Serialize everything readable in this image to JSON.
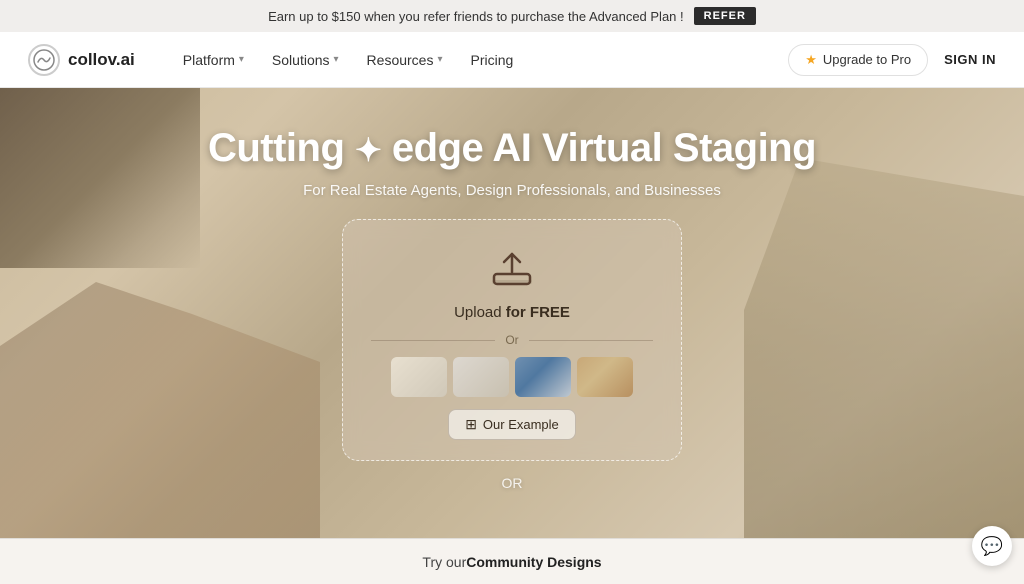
{
  "banner": {
    "text": "Earn up to $150 when you refer friends to purchase the Advanced Plan !",
    "refer_label": "REFER"
  },
  "navbar": {
    "logo_text": "collov.ai",
    "logo_icon": "🏠",
    "nav_items": [
      {
        "label": "Platform",
        "has_dropdown": true
      },
      {
        "label": "Solutions",
        "has_dropdown": true
      },
      {
        "label": "Resources",
        "has_dropdown": true
      },
      {
        "label": "Pricing",
        "has_dropdown": false
      }
    ],
    "upgrade_label": "Upgrade to Pro",
    "signin_label": "SIGN IN"
  },
  "hero": {
    "title_part1": "Cutting ",
    "title_sparkle": "✦",
    "title_part2": " edge AI Virtual Staging",
    "subtitle": "For Real Estate Agents, Design Professionals, and Businesses",
    "upload_card": {
      "upload_label_prefix": "Upload ",
      "upload_label_bold": "for FREE",
      "or_text": "Or",
      "example_btn_label": "Our Example"
    },
    "or_text": "OR"
  },
  "bottom_bar": {
    "text_prefix": "Try our ",
    "text_bold": "Community Designs"
  },
  "chat": {
    "icon": "💬"
  }
}
